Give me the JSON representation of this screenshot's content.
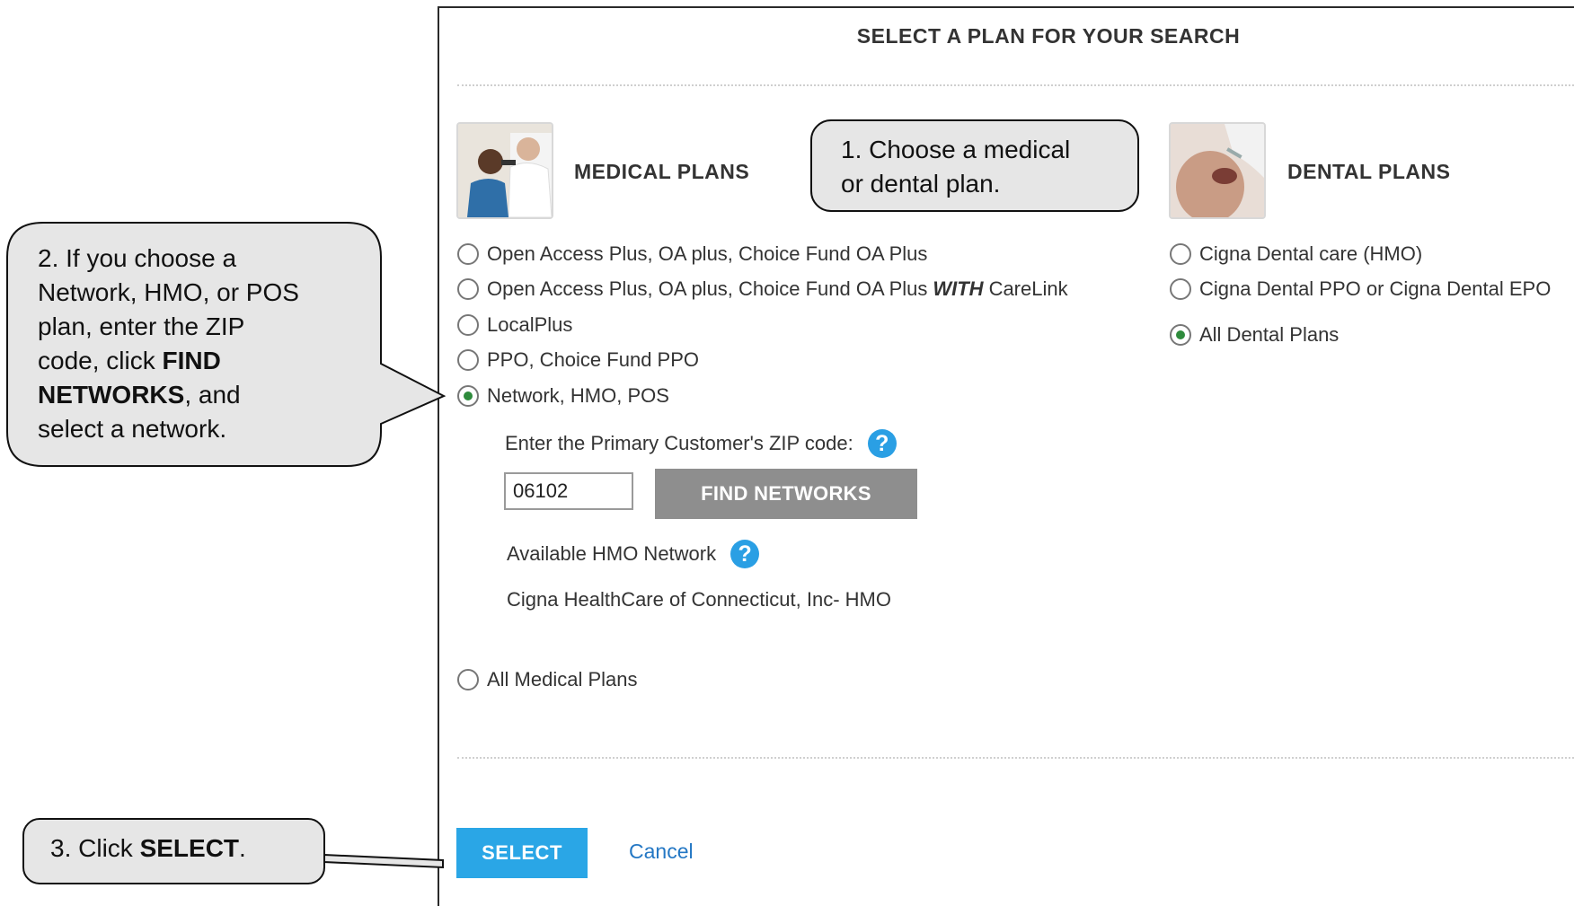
{
  "dialog": {
    "title": "SELECT A PLAN FOR YOUR SEARCH",
    "medical": {
      "heading": "MEDICAL PLANS",
      "options": [
        {
          "label": "Open Access Plus, OA plus, Choice Fund OA Plus",
          "selected": false
        },
        {
          "label_before": "Open Access Plus, OA plus, Choice Fund OA Plus",
          "label_em": "WITH",
          "label_after": "CareLink",
          "selected": false
        },
        {
          "label": "LocalPlus",
          "selected": false
        },
        {
          "label": "PPO, Choice Fund PPO",
          "selected": false
        },
        {
          "label": "Network, HMO, POS",
          "selected": true
        }
      ],
      "zip_label": "Enter the Primary Customer's ZIP code:",
      "zip_value": "06102",
      "find_networks_label": "FIND NETWORKS",
      "available_label": "Available HMO Network",
      "network_name": "Cigna HealthCare of Connecticut, Inc- HMO",
      "all_option": {
        "label": "All Medical Plans",
        "selected": false
      }
    },
    "dental": {
      "heading": "DENTAL PLANS",
      "options": [
        {
          "label": "Cigna Dental care (HMO)",
          "selected": false
        },
        {
          "label": "Cigna Dental PPO or Cigna Dental EPO",
          "selected": false
        },
        {
          "label": "All Dental Plans",
          "selected": true
        }
      ]
    },
    "select_label": "SELECT",
    "cancel_label": "Cancel"
  },
  "callouts": {
    "one": {
      "line1": "1. Choose a medical",
      "line2": "or dental plan."
    },
    "two": {
      "line1": "2. If you choose a",
      "line2": "Network, HMO, or POS",
      "line3": "plan, enter the ZIP",
      "line4_pre": "code, click ",
      "line4_bold": "FIND",
      "line5_bold": "NETWORKS",
      "line5_post": ", and",
      "line6": "select a network."
    },
    "three": {
      "pre": "3. Click ",
      "bold": "SELECT",
      "post": "."
    }
  },
  "colors": {
    "accent": "#2aa6e6",
    "help_icon": "#2a9fe4",
    "radio_selected": "#2e8b3c",
    "callout_fill": "#e6e6e6",
    "link": "#2377c4"
  }
}
